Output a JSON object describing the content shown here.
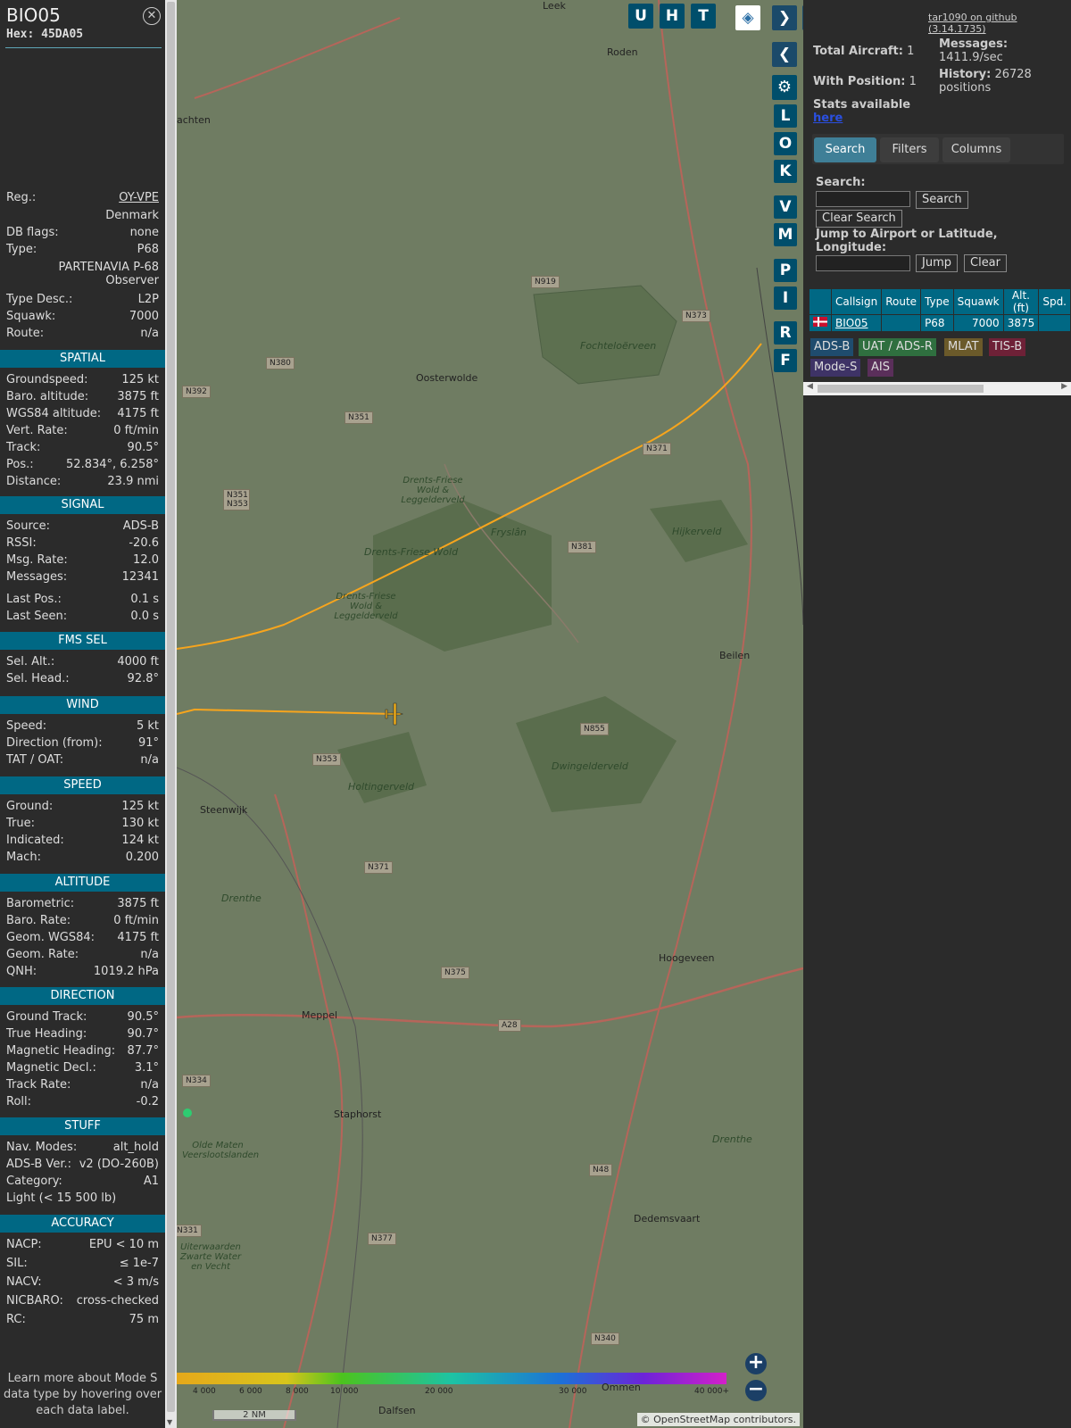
{
  "info": {
    "callsign": "BIO05",
    "hex": "Hex: 45DA05",
    "close_icon": "close-circle-icon",
    "registration": {
      "label": "Reg.:",
      "value": "OY-VPE"
    },
    "country": "Denmark",
    "db_flags": {
      "label": "DB flags:",
      "value": "none"
    },
    "type": {
      "label": "Type:",
      "value": "P68"
    },
    "type_full": "PARTENAVIA P-68 Observer",
    "type_desc": {
      "label": "Type Desc.:",
      "value": "L2P"
    },
    "squawk": {
      "label": "Squawk:",
      "value": "7000"
    },
    "route": {
      "label": "Route:",
      "value": "n/a"
    },
    "spatial": {
      "title": "SPATIAL",
      "rows": [
        {
          "k": "Groundspeed:",
          "v": "125 kt"
        },
        {
          "k": "Baro. altitude:",
          "v": "3875 ft"
        },
        {
          "k": "WGS84 altitude:",
          "v": "4175 ft"
        },
        {
          "k": "Vert. Rate:",
          "v": "0 ft/min"
        },
        {
          "k": "Track:",
          "v": "90.5°"
        },
        {
          "k": "Pos.:",
          "v": "52.834°, 6.258°"
        },
        {
          "k": "Distance:",
          "v": "23.9 nmi"
        }
      ]
    },
    "signal": {
      "title": "SIGNAL",
      "rows": [
        {
          "k": "Source:",
          "v": "ADS-B"
        },
        {
          "k": "RSSI:",
          "v": "-20.6"
        },
        {
          "k": "Msg. Rate:",
          "v": "12.0"
        },
        {
          "k": "Messages:",
          "v": "12341"
        },
        {
          "k": "Last Pos.:",
          "v": "0.1 s"
        },
        {
          "k": "Last Seen:",
          "v": "0.0 s"
        }
      ]
    },
    "fms": {
      "title": "FMS SEL",
      "rows": [
        {
          "k": "Sel. Alt.:",
          "v": "4000 ft"
        },
        {
          "k": "Sel. Head.:",
          "v": "92.8°"
        }
      ]
    },
    "wind": {
      "title": "WIND",
      "rows": [
        {
          "k": "Speed:",
          "v": "5 kt"
        },
        {
          "k": "Direction (from):",
          "v": "91°"
        },
        {
          "k": "TAT / OAT:",
          "v": "n/a"
        }
      ]
    },
    "speed": {
      "title": "SPEED",
      "rows": [
        {
          "k": "Ground:",
          "v": "125 kt"
        },
        {
          "k": "True:",
          "v": "130 kt"
        },
        {
          "k": "Indicated:",
          "v": "124 kt"
        },
        {
          "k": "Mach:",
          "v": "0.200"
        }
      ]
    },
    "altitude": {
      "title": "ALTITUDE",
      "rows": [
        {
          "k": "Barometric:",
          "v": "3875 ft"
        },
        {
          "k": "Baro. Rate:",
          "v": "0 ft/min"
        },
        {
          "k": "Geom. WGS84:",
          "v": "4175 ft"
        },
        {
          "k": "Geom. Rate:",
          "v": "n/a"
        },
        {
          "k": "QNH:",
          "v": "1019.2 hPa"
        }
      ]
    },
    "direction": {
      "title": "DIRECTION",
      "rows": [
        {
          "k": "Ground Track:",
          "v": "90.5°"
        },
        {
          "k": "True Heading:",
          "v": "90.7°"
        },
        {
          "k": "Magnetic Heading:",
          "v": "87.7°"
        },
        {
          "k": "Magnetic Decl.:",
          "v": "3.1°"
        },
        {
          "k": "Track Rate:",
          "v": "n/a"
        },
        {
          "k": "Roll:",
          "v": "-0.2"
        }
      ]
    },
    "stuff": {
      "title": "STUFF",
      "rows": [
        {
          "k": "Nav. Modes:",
          "v": "alt_hold"
        },
        {
          "k": "ADS-B Ver.:",
          "v": "v2 (DO-260B)"
        },
        {
          "k": "Category:",
          "v": "A1"
        },
        {
          "k": "Light (< 15 500 lb)",
          "v": ""
        }
      ]
    },
    "accuracy": {
      "title": "ACCURACY",
      "rows": [
        {
          "k": "NACP:",
          "v": "EPU < 10 m"
        },
        {
          "k": "SIL:",
          "v": "≤ 1e-7"
        },
        {
          "k": "NACV:",
          "v": "< 3 m/s"
        },
        {
          "k": "NICBARO:",
          "v": "cross-checked"
        },
        {
          "k": "RC:",
          "v": "75 m"
        }
      ]
    },
    "learn_more": "Learn more about Mode S data type by hovering over each data label."
  },
  "map": {
    "top_buttons": [
      "U",
      "H",
      "T"
    ],
    "layers_icon": "layers-icon",
    "expand_icon": "chevron-right-icon",
    "collapse_icon": "chevron-left-icon",
    "split_icon": "left-right-arrows-icon",
    "settings_icon": "gear-icon",
    "side_buttons": [
      "L",
      "O",
      "K",
      "V",
      "M",
      "P",
      "I",
      "R",
      "F"
    ],
    "places": [
      {
        "name": "Leek"
      },
      {
        "name": "Roden"
      },
      {
        "name": "achten"
      },
      {
        "name": "Oosterwolde"
      },
      {
        "name": "Fochteloërveen"
      },
      {
        "name": "Drents-Friese Wold & Leggelderveld"
      },
      {
        "name": "Drents-Friese Wold"
      },
      {
        "name": "Drents-Friese Wold & Leggelderveld"
      },
      {
        "name": "Hijkerveld"
      },
      {
        "name": "Beilen"
      },
      {
        "name": "Dwingelderveld"
      },
      {
        "name": "Holtingerveld"
      },
      {
        "name": "Steenwijk"
      },
      {
        "name": "Hoogeveen"
      },
      {
        "name": "Meppel"
      },
      {
        "name": "Staphorst"
      },
      {
        "name": "Olde Maten Veerslootslanden"
      },
      {
        "name": "Dedemsvaart"
      },
      {
        "name": "Uiterwaarden Zwarte Water en Vecht"
      },
      {
        "name": "Ommen"
      },
      {
        "name": "Dalfsen"
      },
      {
        "name": "Fryslân"
      },
      {
        "name": "Drenthe"
      },
      {
        "name": "Drenthe"
      }
    ],
    "roads": [
      "N919",
      "N373",
      "N380",
      "N392",
      "N351",
      "N371",
      "N351 N353",
      "N381",
      "N855",
      "N353",
      "N371",
      "N375",
      "A28",
      "N334",
      "N48",
      "N377",
      "N331",
      "N377",
      "N340"
    ],
    "zoom_in": "+",
    "zoom_out": "−",
    "scale_label": "2 NM",
    "attribution": "© OpenStreetMap contributors.",
    "altitude_scale": [
      "4 000",
      "6 000",
      "8 000",
      "10 000",
      "20 000",
      "30 000",
      "40 000+"
    ],
    "colors": {
      "track": "#f7a51d",
      "aircraft": "#f5b21b",
      "map_bg": "#6f7c62"
    }
  },
  "right": {
    "github": "tar1090 on github (3.14.1735)",
    "total_aircraft": {
      "label": "Total Aircraft:",
      "value": "1"
    },
    "with_position": {
      "label": "With Position:",
      "value": "1"
    },
    "messages": {
      "label": "Messages:",
      "value": "1411.9/sec"
    },
    "history": {
      "label": "History:",
      "value": "26728 positions"
    },
    "stats": "Stats available",
    "stats_link": "here",
    "tabs": [
      "Search",
      "Filters",
      "Columns"
    ],
    "search_label": "Search:",
    "search_button": "Search",
    "clear_search": "Clear Search",
    "jump_label": "Jump to Airport or Latitude, Longitude:",
    "jump_button": "Jump",
    "clear_button": "Clear",
    "table": {
      "headers": [
        "",
        "Callsign",
        "Route",
        "Type",
        "Squawk",
        "Alt. (ft)",
        "Spd."
      ],
      "rows": [
        {
          "flag": "flag-denmark-icon",
          "callsign": "BIO05",
          "route": "",
          "type": "P68",
          "squawk": "7000",
          "alt": "3875",
          "spd": ""
        }
      ]
    },
    "badges": [
      {
        "label": "ADS-B",
        "bg": "#1f4c6e"
      },
      {
        "label": "UAT / ADS-R",
        "bg": "#2f6f3f"
      },
      {
        "label": "MLAT",
        "bg": "#6b5a2a"
      },
      {
        "label": "TIS-B",
        "bg": "#6e2137"
      },
      {
        "label": "Mode-S",
        "bg": "#3e3366"
      },
      {
        "label": "AIS",
        "bg": "#5a2f5a"
      }
    ]
  }
}
